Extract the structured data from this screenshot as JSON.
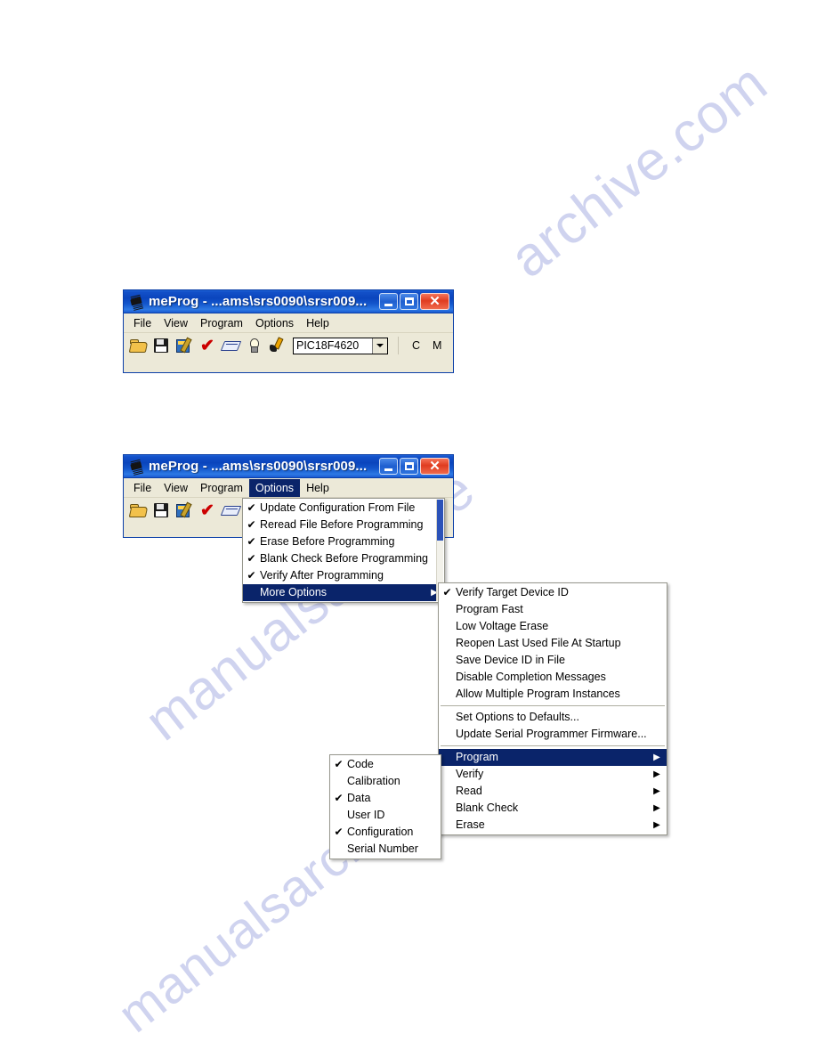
{
  "watermark": {
    "line1": "archive.com",
    "line2": "manualsarchive",
    "line3": "manualsarchive"
  },
  "window_top": {
    "title": "meProg - ...ams\\srs0090\\srsr009...",
    "title_icon": "chip-icon",
    "controls": {
      "minimize": "minimize-icon",
      "maximize": "maximize-icon",
      "close": "close-icon"
    },
    "menubar": [
      "File",
      "View",
      "Program",
      "Options",
      "Help"
    ],
    "toolbar": {
      "icons": [
        "open-file-icon",
        "save-file-icon",
        "program-device-icon",
        "verify-icon",
        "erase-icon",
        "blank-check-icon",
        "read-device-icon"
      ],
      "device_combo_value": "PIC18F4620",
      "indicator_c": "C",
      "indicator_m": "M"
    }
  },
  "window_bottom": {
    "title": "meProg - ...ams\\srs0090\\srsr009...",
    "title_icon": "chip-icon",
    "controls": {
      "minimize": "minimize-icon",
      "maximize": "maximize-icon",
      "close": "close-icon"
    },
    "menubar": [
      "File",
      "View",
      "Program",
      "Options",
      "Help"
    ],
    "active_menu": "Options",
    "toolbar": {
      "icons": [
        "open-file-icon",
        "save-file-icon",
        "program-device-icon",
        "verify-icon",
        "erase-icon"
      ]
    }
  },
  "options_menu": {
    "items": [
      {
        "label": "Update Configuration From File",
        "checked": true,
        "submenu": false,
        "selected": false
      },
      {
        "label": "Reread File Before Programming",
        "checked": true,
        "submenu": false,
        "selected": false
      },
      {
        "label": "Erase Before Programming",
        "checked": true,
        "submenu": false,
        "selected": false
      },
      {
        "label": "Blank Check Before Programming",
        "checked": true,
        "submenu": false,
        "selected": false
      },
      {
        "label": "Verify After Programming",
        "checked": true,
        "submenu": false,
        "selected": false
      },
      {
        "label": "More Options",
        "checked": false,
        "submenu": true,
        "selected": true
      }
    ]
  },
  "more_options_menu": {
    "items": [
      {
        "label": "Verify Target Device ID",
        "checked": true,
        "submenu": false,
        "selected": false,
        "separator_before": false
      },
      {
        "label": "Program Fast",
        "checked": false,
        "submenu": false,
        "selected": false,
        "separator_before": false
      },
      {
        "label": "Low Voltage Erase",
        "checked": false,
        "submenu": false,
        "selected": false,
        "separator_before": false
      },
      {
        "label": "Reopen Last Used File At Startup",
        "checked": false,
        "submenu": false,
        "selected": false,
        "separator_before": false
      },
      {
        "label": "Save Device ID in File",
        "checked": false,
        "submenu": false,
        "selected": false,
        "separator_before": false
      },
      {
        "label": "Disable Completion Messages",
        "checked": false,
        "submenu": false,
        "selected": false,
        "separator_before": false
      },
      {
        "label": "Allow Multiple Program Instances",
        "checked": false,
        "submenu": false,
        "selected": false,
        "separator_before": false
      },
      {
        "label": "Set Options to Defaults...",
        "checked": false,
        "submenu": false,
        "selected": false,
        "separator_before": true
      },
      {
        "label": "Update Serial Programmer Firmware...",
        "checked": false,
        "submenu": false,
        "selected": false,
        "separator_before": false
      },
      {
        "label": "Program",
        "checked": false,
        "submenu": true,
        "selected": true,
        "separator_before": true
      },
      {
        "label": "Verify",
        "checked": false,
        "submenu": true,
        "selected": false,
        "separator_before": false
      },
      {
        "label": "Read",
        "checked": false,
        "submenu": true,
        "selected": false,
        "separator_before": false
      },
      {
        "label": "Blank Check",
        "checked": false,
        "submenu": true,
        "selected": false,
        "separator_before": false
      },
      {
        "label": "Erase",
        "checked": false,
        "submenu": true,
        "selected": false,
        "separator_before": false
      }
    ]
  },
  "program_submenu": {
    "items": [
      {
        "label": "Code",
        "checked": true,
        "submenu": false,
        "selected": false
      },
      {
        "label": "Calibration",
        "checked": false,
        "submenu": false,
        "selected": false
      },
      {
        "label": "Data",
        "checked": true,
        "submenu": false,
        "selected": false
      },
      {
        "label": "User ID",
        "checked": false,
        "submenu": false,
        "selected": false
      },
      {
        "label": "Configuration",
        "checked": true,
        "submenu": false,
        "selected": false
      },
      {
        "label": "Serial Number",
        "checked": false,
        "submenu": false,
        "selected": false
      }
    ]
  },
  "glyphs": {
    "check": "✔",
    "arrow": "▶",
    "close": "✕"
  },
  "colors": {
    "titlebar_blue": "#0a45bd",
    "menu_highlight": "#0a246a",
    "window_face": "#ece9d8",
    "close_red": "#e03c20",
    "watermark": "#ccd0ee",
    "check_red": "#cc0000"
  }
}
